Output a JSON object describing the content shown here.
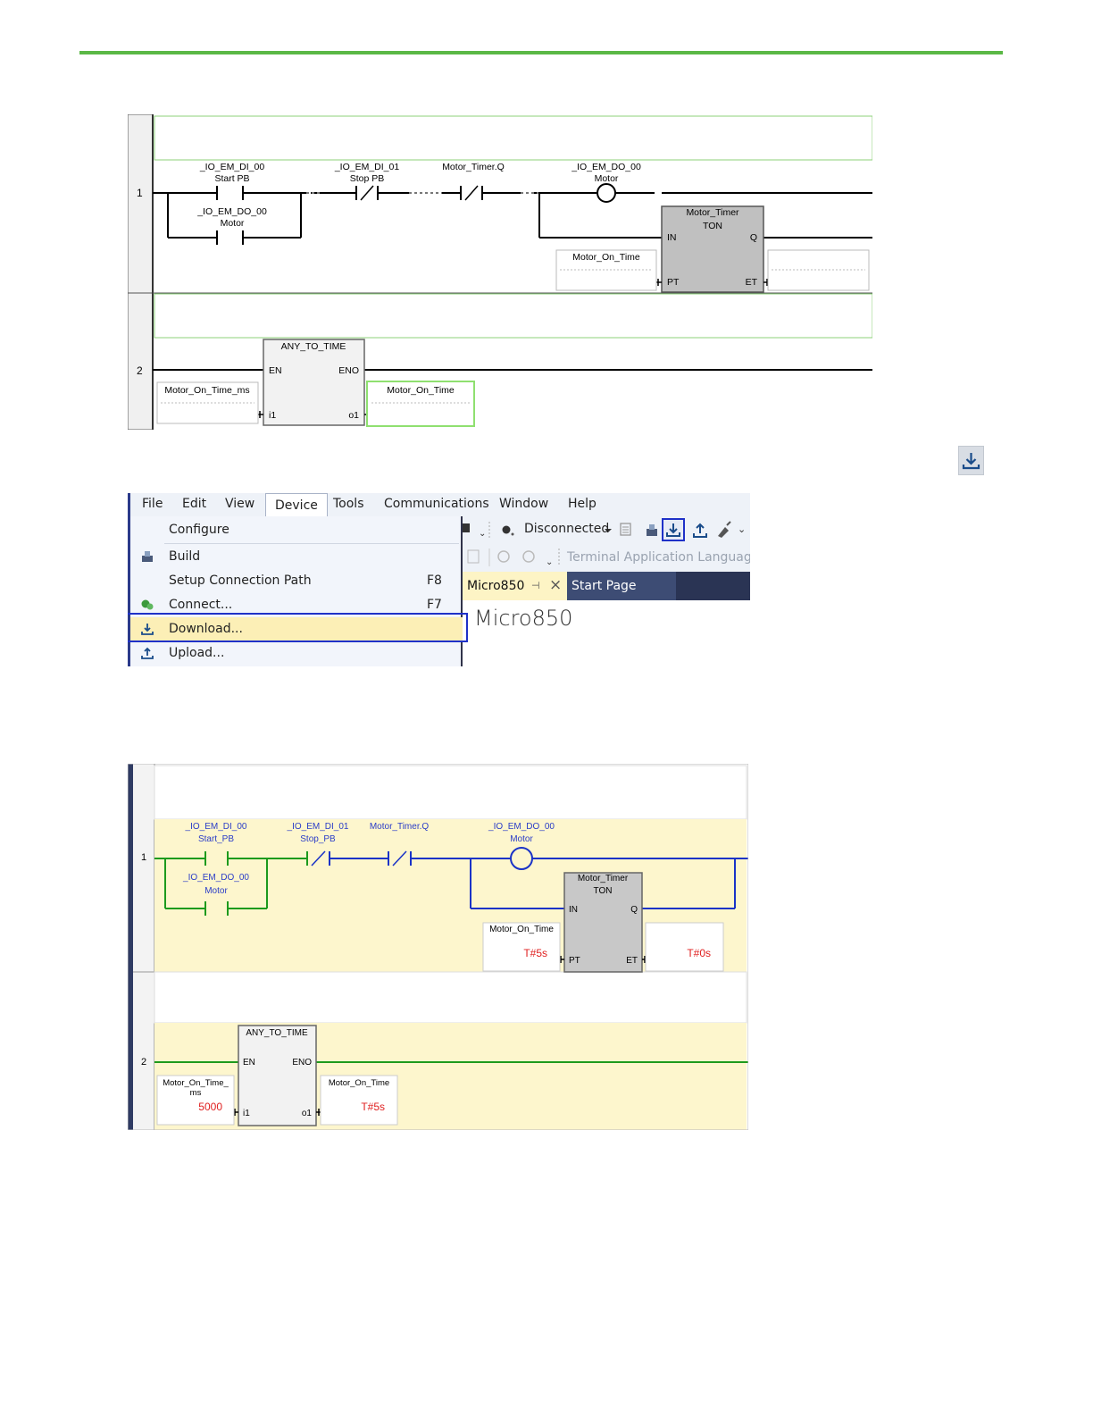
{
  "ladder_offline": {
    "rung1_number": "1",
    "rung2_number": "2",
    "contact1_name": "_IO_EM_DI_00",
    "contact1_alias": "Start PB",
    "contact2_name": "_IO_EM_DI_01",
    "contact2_alias": "Stop PB",
    "contact3_name": "Motor_Timer.Q",
    "coil_name": "_IO_EM_DO_00",
    "coil_alias": "Motor",
    "branch_contact_name": "_IO_EM_DO_00",
    "branch_contact_alias": "Motor",
    "timer_instance": "Motor_Timer",
    "timer_type": "TON",
    "timer_pin_in": "IN",
    "timer_pin_q": "Q",
    "timer_pin_pt": "PT",
    "timer_pin_et": "ET",
    "pt_variable": "Motor_On_Time",
    "convert_block": "ANY_TO_TIME",
    "convert_pin_en": "EN",
    "convert_pin_eno": "ENO",
    "convert_pin_i1": "i1",
    "convert_pin_o1": "o1",
    "convert_input_var": "Motor_On_Time_ms",
    "convert_output_var": "Motor_On_Time"
  },
  "menu": {
    "bar": [
      "File",
      "Edit",
      "View",
      "Device",
      "Tools",
      "Communications",
      "Window",
      "Help"
    ],
    "active_menu": "Device",
    "items": {
      "configure": "Configure",
      "build": "Build",
      "setup_path": "Setup Connection Path",
      "setup_path_shortcut": "F8",
      "connect": "Connect...",
      "connect_shortcut": "F7",
      "download": "Download...",
      "upload": "Upload..."
    },
    "status": "Disconnected",
    "terminal_language": "Terminal Application Language:",
    "tab_active": "Micro850",
    "tab_other": "Start Page",
    "content_title": "Micro850",
    "highlight_color": "#1f31c8",
    "hover_color": "#fcefb6"
  },
  "ladder_online": {
    "rung1_number": "1",
    "rung2_number": "2",
    "contact1_name": "_IO_EM_DI_00",
    "contact1_alias": "Start_PB",
    "contact2_name": "_IO_EM_DI_01",
    "contact2_alias": "Stop_PB",
    "contact3_name": "Motor_Timer.Q",
    "coil_name": "_IO_EM_DO_00",
    "coil_alias": "Motor",
    "branch_contact_name": "_IO_EM_DO_00",
    "branch_contact_alias": "Motor",
    "timer_instance": "Motor_Timer",
    "timer_type": "TON",
    "timer_pin_in": "IN",
    "timer_pin_q": "Q",
    "timer_pin_pt": "PT",
    "timer_pin_et": "ET",
    "pt_variable": "Motor_On_Time",
    "pt_value": "T#5s",
    "et_value": "T#0s",
    "convert_block": "ANY_TO_TIME",
    "convert_pin_en": "EN",
    "convert_pin_eno": "ENO",
    "convert_pin_i1": "i1",
    "convert_pin_o1": "o1",
    "convert_input_var_line1": "Motor_On_Time_",
    "convert_input_var_line2": "ms",
    "convert_input_value": "5000",
    "convert_output_var": "Motor_On_Time",
    "convert_output_value": "T#5s",
    "power_color": "#1a33c7",
    "value_color": "#e02020",
    "online_bg": "#fdf6cd"
  },
  "colors": {
    "accent_green": "#5bb846"
  }
}
